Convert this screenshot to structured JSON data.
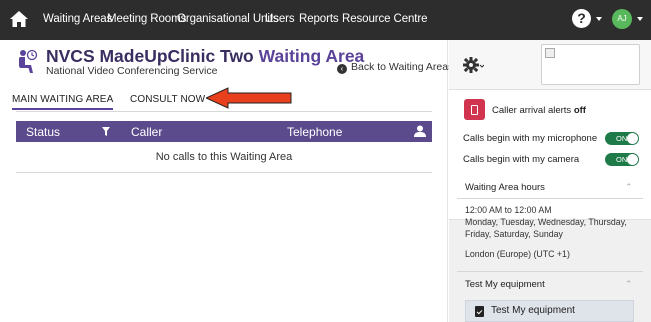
{
  "nav": {
    "items": [
      "Waiting Areas",
      "Meeting Rooms",
      "Organisational Units",
      "Users",
      "Reports",
      "Resource Centre"
    ],
    "avatar_initials": "AJ",
    "help_glyph": "?"
  },
  "header": {
    "clinic": "NVCS MadeUpClinic Two",
    "suffix": "Waiting Area",
    "subtitle": "National Video Conferencing Service",
    "back_link": "Back to Waiting Areas"
  },
  "tabs": [
    "MAIN WAITING AREA",
    "CONSULT NOW"
  ],
  "table": {
    "columns": [
      "Status",
      "Caller",
      "Telephone"
    ],
    "empty_message": "No calls to this Waiting Area"
  },
  "sidebar": {
    "alerts_label": "Caller arrival alerts",
    "alerts_state": "off",
    "microphone_label": "Calls begin with my microphone",
    "microphone_toggle": "ON",
    "camera_label": "Calls begin with my camera",
    "camera_toggle": "ON",
    "hours_title": "Waiting Area hours",
    "hours_time": "12:00 AM to 12:00 AM",
    "hours_days": "Monday, Tuesday, Wednesday, Thursday, Friday, Saturday, Sunday",
    "hours_timezone": "London (Europe) (UTC +1)",
    "equipment_title": "Test My equipment",
    "equipment_button": "Test My equipment"
  },
  "colors": {
    "nav_bg": "#2d2d2d",
    "brand_purple": "#5a4398",
    "table_header": "#5b4a8c",
    "toggle_on": "#1f7a4a",
    "alert_red": "#d0344f",
    "arrow_red": "#e8401c"
  },
  "icons": [
    "home-icon",
    "help-icon",
    "avatar",
    "waiting-area-icon",
    "back-circle-icon",
    "filter-icon",
    "person-icon",
    "gear-icon",
    "alert-phone-icon",
    "clipboard-icon"
  ]
}
